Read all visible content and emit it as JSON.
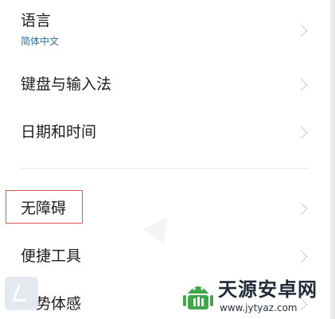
{
  "settings": {
    "language": {
      "label": "语言",
      "value": "简体中文"
    },
    "keyboard": {
      "label": "键盘与输入法"
    },
    "datetime": {
      "label": "日期和时间"
    },
    "accessibility": {
      "label": "无障碍"
    },
    "shortcuts": {
      "label": "便捷工具"
    },
    "gestures": {
      "label": "手势体感"
    }
  },
  "watermark": {
    "title": "天源安卓网",
    "url": "www.jytyaz.com"
  },
  "colors": {
    "highlight": "#d9534f",
    "sublabel": "#2f6f9a",
    "logo_green": "#3fa64a"
  }
}
